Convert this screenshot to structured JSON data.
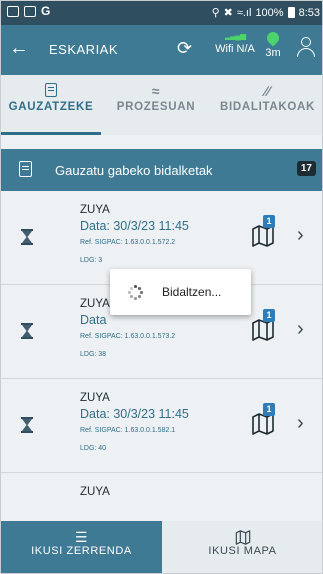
{
  "statusbar": {
    "left_letter": "G",
    "right_text": "100% ",
    "time": "8:53"
  },
  "appbar": {
    "back_icon": "arrow-left-icon",
    "title": "ESKARIAK",
    "wifi_label": "Wifi N/A",
    "location_label": "3m",
    "accent_color": "#3e7a94",
    "indicator_color": "#4cd36b"
  },
  "tabs": [
    {
      "label": "GAUZATZEKE",
      "icon": "document-icon",
      "active": true
    },
    {
      "label": "PROZESUAN",
      "icon": "wifi-icon",
      "active": false
    },
    {
      "label": "BIDALITAKOAK",
      "icon": "signature-icon",
      "active": false
    }
  ],
  "section": {
    "title": "Gauzatu gabeko bidalketak",
    "count": "17"
  },
  "rows": [
    {
      "name": "ZUYA",
      "date": "Data: 30/3/23 11:45",
      "ref": "Ref. SIGPAC: 1.63.0.0.1.572.2",
      "ldg": "LDG: 3",
      "map_badge": "1"
    },
    {
      "name": "ZUYA",
      "date": "Data",
      "ref": "Ref. SIGPAC: 1.63.0.0.1.573.2",
      "ldg": "LDG: 38",
      "map_badge": "1"
    },
    {
      "name": "ZUYA",
      "date": "Data: 30/3/23 11:45",
      "ref": "Ref. SIGPAC: 1.63.0.0.1.582.1",
      "ldg": "LDG: 40",
      "map_badge": "1"
    },
    {
      "name": "ZUYA",
      "date": "",
      "ref": "",
      "ldg": "",
      "map_badge": ""
    }
  ],
  "dialog": {
    "text": "Bidaltzen..."
  },
  "bottom_nav": {
    "list_label": "IKUSI ZERRENDA",
    "map_label": "IKUSI MAPA"
  }
}
